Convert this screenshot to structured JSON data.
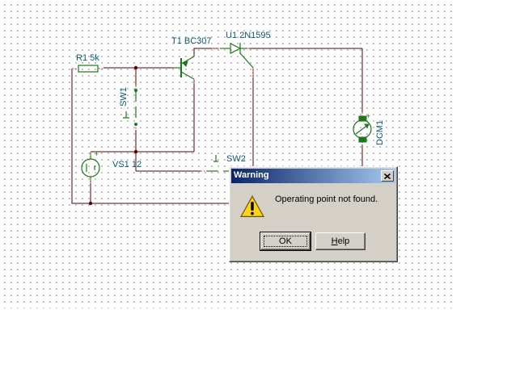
{
  "schematic": {
    "labels": {
      "r1": "R1 5k",
      "t1": "T1 BC307",
      "u1": "U1 2N1595",
      "sw1": "SW1",
      "sw2": "SW2",
      "vs1": "VS1 12",
      "dcm1": "DCM1",
      "plus": "+"
    }
  },
  "dialog": {
    "title": "Warning",
    "message": "Operating point not found.",
    "ok_label": "OK",
    "help_first": "H",
    "help_rest": "elp",
    "icon": "warning-icon"
  },
  "colors": {
    "wire": "#5a0000",
    "component": "#1a7a1a",
    "label": "#0a5a7a",
    "titlebar_start": "#0a246a",
    "titlebar_end": "#a6caf0",
    "dialog_bg": "#d4d0c8"
  }
}
